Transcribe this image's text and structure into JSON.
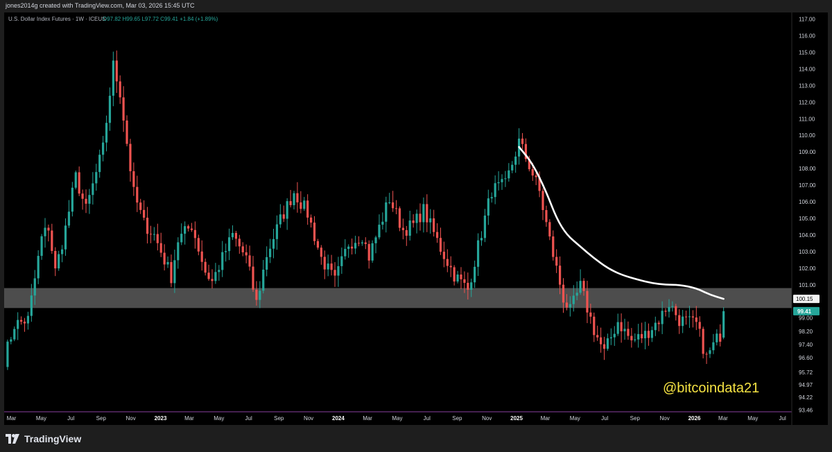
{
  "header": {
    "attribution": "jones2014g created with TradingView.com, Mar 03, 2026 15:45 UTC"
  },
  "legend": {
    "symbol": "U.S. Dollar Index Futures · 1W · ICEUS",
    "ohlc": "O97.82 H99.65 L97.72 C99.41 +1.84 (+1.89%)"
  },
  "price_labels": {
    "current": "99.41",
    "line": "100.15"
  },
  "watermark": "@bitcoindata21",
  "footer": {
    "brand": "TradingView"
  },
  "colors": {
    "up": "#26a69a",
    "down": "#ef5350",
    "zone": "#5a5a5a",
    "curve": "#ffffff",
    "watermark": "#f6e343",
    "background": "#000000"
  },
  "chart_data": {
    "type": "candlestick",
    "title": "U.S. Dollar Index Futures · 1W · ICEUS",
    "x_axis": {
      "range": [
        "2022-02-14",
        "2026-07-20"
      ],
      "ticks": [
        {
          "label": "Mar",
          "date": "2022-03-01",
          "bold": false
        },
        {
          "label": "May",
          "date": "2022-05-01",
          "bold": false
        },
        {
          "label": "Jul",
          "date": "2022-07-01",
          "bold": false
        },
        {
          "label": "Sep",
          "date": "2022-09-01",
          "bold": false
        },
        {
          "label": "Nov",
          "date": "2022-11-01",
          "bold": false
        },
        {
          "label": "2023",
          "date": "2023-01-01",
          "bold": true
        },
        {
          "label": "Mar",
          "date": "2023-03-01",
          "bold": false
        },
        {
          "label": "May",
          "date": "2023-05-01",
          "bold": false
        },
        {
          "label": "Jul",
          "date": "2023-07-01",
          "bold": false
        },
        {
          "label": "Sep",
          "date": "2023-09-01",
          "bold": false
        },
        {
          "label": "Nov",
          "date": "2023-11-01",
          "bold": false
        },
        {
          "label": "2024",
          "date": "2024-01-01",
          "bold": true
        },
        {
          "label": "Mar",
          "date": "2024-03-01",
          "bold": false
        },
        {
          "label": "May",
          "date": "2024-05-01",
          "bold": false
        },
        {
          "label": "Jul",
          "date": "2024-07-01",
          "bold": false
        },
        {
          "label": "Sep",
          "date": "2024-09-01",
          "bold": false
        },
        {
          "label": "Nov",
          "date": "2024-11-01",
          "bold": false
        },
        {
          "label": "2025",
          "date": "2025-01-01",
          "bold": true
        },
        {
          "label": "Mar",
          "date": "2025-03-01",
          "bold": false
        },
        {
          "label": "May",
          "date": "2025-05-01",
          "bold": false
        },
        {
          "label": "Jul",
          "date": "2025-07-01",
          "bold": false
        },
        {
          "label": "Sep",
          "date": "2025-09-01",
          "bold": false
        },
        {
          "label": "Nov",
          "date": "2025-11-01",
          "bold": false
        },
        {
          "label": "2026",
          "date": "2026-01-01",
          "bold": true
        },
        {
          "label": "Mar",
          "date": "2026-03-01",
          "bold": false
        },
        {
          "label": "May",
          "date": "2026-05-01",
          "bold": false
        },
        {
          "label": "Jul",
          "date": "2026-07-01",
          "bold": false
        }
      ]
    },
    "y_axis": {
      "ylim": [
        93.35,
        117.4
      ],
      "ticks": [
        "117.00",
        "116.00",
        "115.00",
        "114.00",
        "113.00",
        "112.00",
        "111.00",
        "110.00",
        "109.00",
        "108.00",
        "107.00",
        "106.00",
        "105.00",
        "104.00",
        "103.00",
        "102.00",
        "101.00",
        "99.00",
        "98.20",
        "97.40",
        "96.60",
        "95.72",
        "94.97",
        "94.22",
        "93.46"
      ]
    },
    "zone": {
      "low": 99.6,
      "high": 100.8
    },
    "anchors": [
      [
        "2022-02-14",
        96.5
      ],
      [
        "2022-03-07",
        98.6
      ],
      [
        "2022-04-04",
        98.9
      ],
      [
        "2022-05-02",
        103.8
      ],
      [
        "2022-05-16",
        104.5
      ],
      [
        "2022-05-30",
        101.8
      ],
      [
        "2022-06-20",
        104.4
      ],
      [
        "2022-07-11",
        107.5
      ],
      [
        "2022-08-01",
        105.5
      ],
      [
        "2022-09-05",
        109.2
      ],
      [
        "2022-09-26",
        114.2
      ],
      [
        "2022-10-10",
        112.6
      ],
      [
        "2022-11-07",
        106.5
      ],
      [
        "2022-11-28",
        104.7
      ],
      [
        "2022-12-19",
        104.0
      ],
      [
        "2023-01-23",
        101.5
      ],
      [
        "2023-02-06",
        103.7
      ],
      [
        "2023-03-06",
        104.6
      ],
      [
        "2023-04-03",
        101.8
      ],
      [
        "2023-04-17",
        101.2
      ],
      [
        "2023-05-29",
        104.0
      ],
      [
        "2023-06-26",
        102.6
      ],
      [
        "2023-07-17",
        99.9
      ],
      [
        "2023-08-07",
        102.8
      ],
      [
        "2023-09-04",
        104.9
      ],
      [
        "2023-10-02",
        106.6
      ],
      [
        "2023-10-30",
        105.3
      ],
      [
        "2023-11-27",
        102.6
      ],
      [
        "2023-12-25",
        101.2
      ],
      [
        "2024-01-22",
        103.5
      ],
      [
        "2024-02-19",
        104.0
      ],
      [
        "2024-03-04",
        102.7
      ],
      [
        "2024-04-15",
        106.2
      ],
      [
        "2024-05-13",
        104.3
      ],
      [
        "2024-06-03",
        104.6
      ],
      [
        "2024-06-24",
        105.5
      ],
      [
        "2024-07-29",
        103.2
      ],
      [
        "2024-08-26",
        101.6
      ],
      [
        "2024-09-23",
        100.7
      ],
      [
        "2024-10-14",
        103.3
      ],
      [
        "2024-11-11",
        106.7
      ],
      [
        "2024-12-09",
        107.0
      ],
      [
        "2025-01-06",
        109.6
      ],
      [
        "2025-01-27",
        108.2
      ],
      [
        "2025-02-17",
        106.6
      ],
      [
        "2025-03-10",
        103.7
      ],
      [
        "2025-04-07",
        100.2
      ],
      [
        "2025-04-21",
        99.4
      ],
      [
        "2025-05-12",
        100.9
      ],
      [
        "2025-06-09",
        98.3
      ],
      [
        "2025-06-30",
        96.9
      ],
      [
        "2025-07-28",
        98.8
      ],
      [
        "2025-08-25",
        97.6
      ],
      [
        "2025-09-22",
        98.0
      ],
      [
        "2025-10-20",
        98.9
      ],
      [
        "2025-11-10",
        99.9
      ],
      [
        "2025-12-01",
        98.9
      ],
      [
        "2026-01-05",
        98.6
      ],
      [
        "2026-01-26",
        96.6
      ],
      [
        "2026-02-16",
        97.7
      ],
      [
        "2026-02-23",
        97.57
      ]
    ],
    "last_candle": {
      "date": "2026-03-02",
      "open": 97.82,
      "high": 99.65,
      "low": 97.72,
      "close": 99.41,
      "change": 1.84,
      "change_pct": 1.89
    },
    "curve": [
      [
        "2025-01-06",
        109.3
      ],
      [
        "2025-02-03",
        108.3
      ],
      [
        "2025-03-03",
        106.6
      ],
      [
        "2025-03-24",
        105.0
      ],
      [
        "2025-04-14",
        104.0
      ],
      [
        "2025-05-12",
        103.3
      ],
      [
        "2025-06-09",
        102.6
      ],
      [
        "2025-07-07",
        102.0
      ],
      [
        "2025-08-04",
        101.6
      ],
      [
        "2025-09-08",
        101.3
      ],
      [
        "2025-10-06",
        101.1
      ],
      [
        "2025-11-03",
        101.0
      ],
      [
        "2025-12-01",
        101.0
      ],
      [
        "2026-01-05",
        100.8
      ],
      [
        "2026-02-02",
        100.4
      ],
      [
        "2026-03-02",
        100.15
      ]
    ]
  }
}
